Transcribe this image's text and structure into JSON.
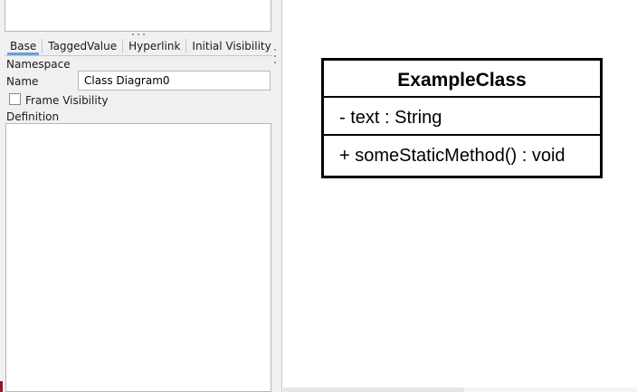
{
  "panel": {
    "tabs": [
      {
        "label": "Base",
        "active": true
      },
      {
        "label": "TaggedValue",
        "active": false
      },
      {
        "label": "Hyperlink",
        "active": false
      },
      {
        "label": "Initial Visibility",
        "active": false
      }
    ],
    "namespace_label": "Namespace",
    "name_label": "Name",
    "name_value": "Class Diagram0",
    "frame_visibility_label": "Frame Visibility",
    "frame_visibility_checked": false,
    "definition_label": "Definition",
    "definition_value": ""
  },
  "diagram": {
    "class": {
      "name": "ExampleClass",
      "attributes": [
        "- text : String"
      ],
      "operations": [
        "+ someStaticMethod() : void"
      ]
    }
  },
  "colors": {
    "active_tab_underline": "#6a9fd8",
    "panel_background": "#f0f0f0"
  }
}
